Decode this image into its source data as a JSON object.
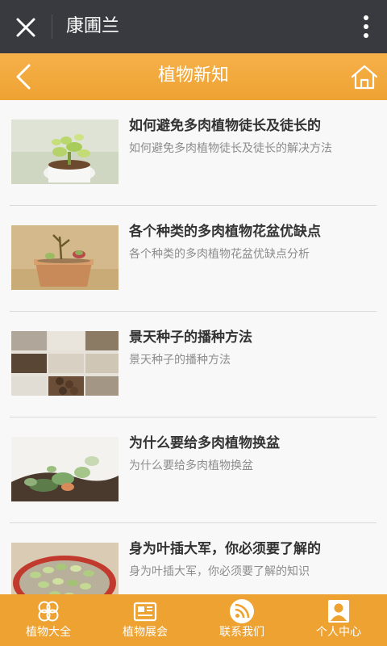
{
  "wechat_bar": {
    "title": "康圃兰"
  },
  "header": {
    "title": "植物新知"
  },
  "articles": [
    {
      "title": "如何避免多肉植物徒长及徒长的",
      "summary": "如何避免多肉植物徒长及徒长的解决方法"
    },
    {
      "title": "各个种类的多肉植物花盆优缺点",
      "summary": "各个种类的多肉植物花盆优缺点分析"
    },
    {
      "title": "景天种子的播种方法",
      "summary": "景天种子的播种方法"
    },
    {
      "title": "为什么要给多肉植物换盆",
      "summary": "为什么要给多肉植物换盆"
    },
    {
      "title": "身为叶插大军，你必须要了解的",
      "summary": "身为叶插大军，你必须要了解的知识"
    }
  ],
  "tabbar": {
    "items": [
      {
        "label": "植物大全",
        "icon": "clover-icon"
      },
      {
        "label": "植物展会",
        "icon": "newspaper-icon"
      },
      {
        "label": "联系我们",
        "icon": "rss-icon"
      },
      {
        "label": "个人中心",
        "icon": "user-icon"
      }
    ]
  },
  "colors": {
    "accent": "#eea232",
    "top_bar": "#393a3f"
  }
}
